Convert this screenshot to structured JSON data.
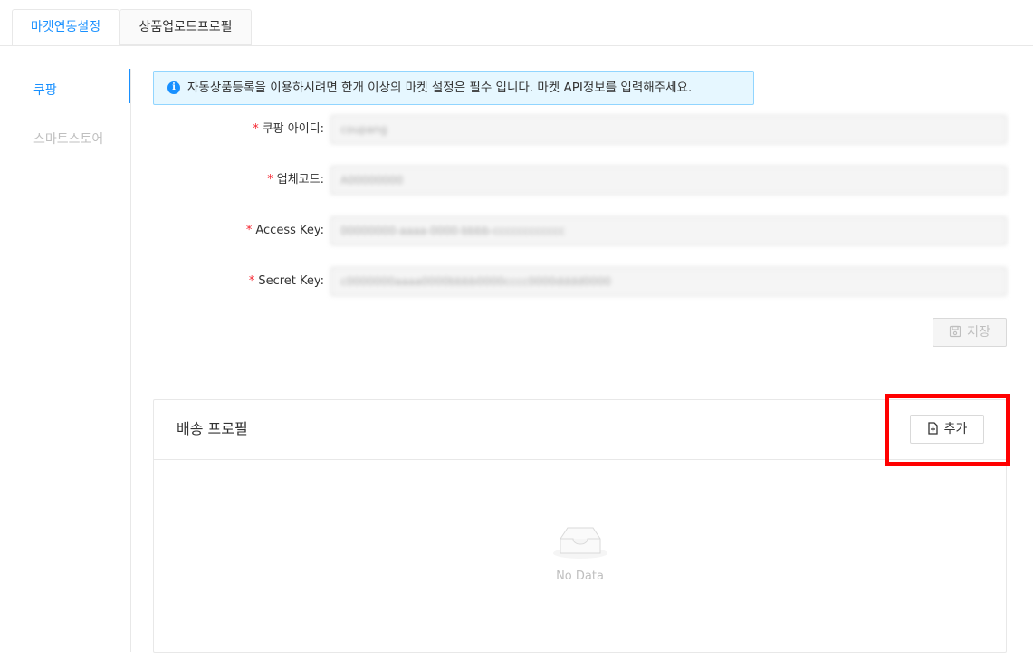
{
  "tabs": [
    {
      "label": "마켓연동설정",
      "active": true
    },
    {
      "label": "상품업로드프로필",
      "active": false
    }
  ],
  "side_menu": {
    "items": [
      {
        "label": "쿠팡",
        "active": true
      },
      {
        "label": "스마트스토어",
        "active": false
      }
    ]
  },
  "alert": {
    "icon": "info-icon",
    "text": "자동상품등록을 이용하시려면 한개 이상의 마켓 설정은 필수 입니다. 마켓 API정보를 입력해주세요."
  },
  "form": {
    "fields": [
      {
        "label": "쿠팡 아이디:",
        "value": "coupang"
      },
      {
        "label": "업체코드:",
        "value": "A00000000"
      },
      {
        "label": "Access Key:",
        "value": "00000000-aaaa-0000-bbbb-cccccccccccc"
      },
      {
        "label": "Secret Key:",
        "value": "c0000000aaaa0000bbbb0000cccc0000dddd0000"
      }
    ],
    "save_label": "저장",
    "save_icon": "save-icon"
  },
  "shipping_card": {
    "title": "배송 프로필",
    "add_label": "추가",
    "add_icon": "file-add-icon",
    "empty_text": "No Data",
    "empty_icon": "inbox-icon"
  },
  "colors": {
    "accent": "#1890ff",
    "highlight": "#ff0000",
    "required": "#f5222d"
  }
}
